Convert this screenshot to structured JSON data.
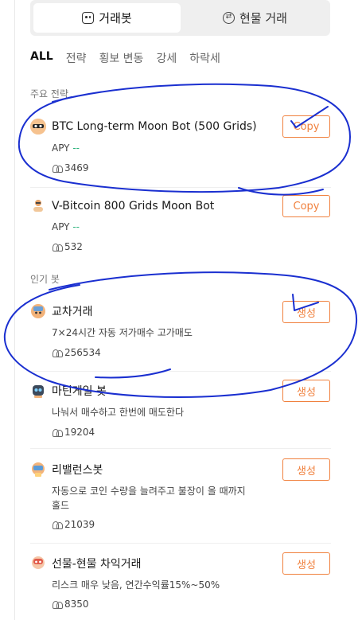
{
  "tabs": [
    {
      "label": "거래봇",
      "icon": "bot-icon",
      "active": true
    },
    {
      "label": "현물 거래",
      "icon": "swap-icon",
      "active": false
    }
  ],
  "categories": [
    "ALL",
    "전략",
    "횡보 변동",
    "강세",
    "하락세"
  ],
  "sections": {
    "featured": "주요 전략",
    "popular": "인기 봇"
  },
  "featured_bots": [
    {
      "title": "BTC Long-term Moon Bot (500 Grids)",
      "apy_label": "APY",
      "apy_value": "--",
      "users": "3469",
      "action": "Copy",
      "avatar": "btc-moon-avatar"
    },
    {
      "title": "V-Bitcoin 800 Grids Moon Bot",
      "apy_label": "APY",
      "apy_value": "--",
      "users": "532",
      "action": "Copy",
      "avatar": "vbitcoin-avatar"
    }
  ],
  "popular_bots": [
    {
      "title": "교차거래",
      "desc": "7×24시간 자동 저가매수 고가매도",
      "users": "256534",
      "action": "생성",
      "avatar": "cross-trade-avatar"
    },
    {
      "title": "마틴게일 봇",
      "desc": "나눠서 매수하고 한번에 매도한다",
      "users": "19204",
      "action": "생성",
      "avatar": "martingale-avatar"
    },
    {
      "title": "리밸런스봇",
      "desc": "자동으로 코인 수량을 늘려주고 불장이 올 때까지 홀드",
      "users": "21039",
      "action": "생성",
      "avatar": "rebalance-avatar"
    },
    {
      "title": "선물-현물 차익거래",
      "desc": "리스크 매우 낮음, 연간수익률15%~50%",
      "users": "8350",
      "action": "생성",
      "avatar": "arbitrage-avatar"
    }
  ],
  "colors": {
    "accent": "#f0813e",
    "annotation": "#1a2fd0",
    "apy_dash": "#2ab27b"
  }
}
